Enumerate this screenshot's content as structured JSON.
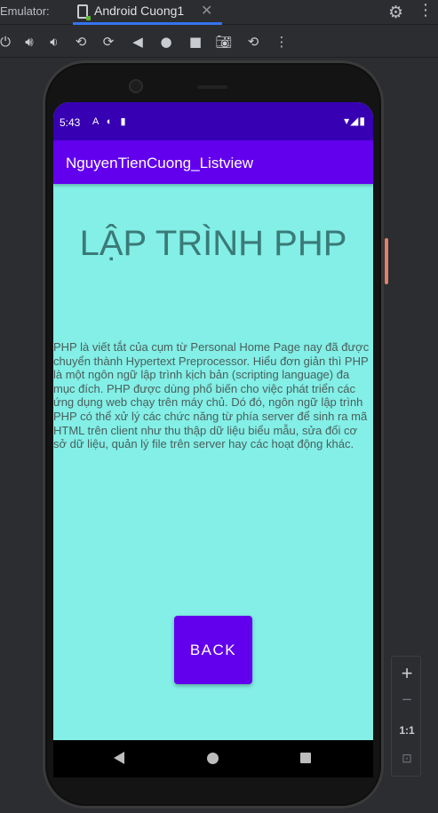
{
  "emulator": {
    "label": "Emulator:",
    "tab_title": "Android Cuong1",
    "tab_close": "✕",
    "settings_icon": "gear-icon",
    "more_icon": "more-options-icon"
  },
  "toolbar": {
    "icons": [
      "power-icon",
      "volume-up-icon",
      "volume-down-icon",
      "rotate-left-icon",
      "rotate-right-icon",
      "back-icon",
      "home-icon",
      "overview-icon",
      "camera-icon",
      "restore-icon",
      "more-icon"
    ]
  },
  "device": {
    "status_time": "5:43",
    "status_left_icons": "A ◐ ▮",
    "status_right_icons": "▾◢▮",
    "app_title": "NguyenTienCuong_Listview",
    "headline": "LẬP TRÌNH PHP",
    "body": "PHP là viết tắt của cụm từ Personal Home Page nay đã được chuyển thành Hypertext Preprocessor. Hiểu đơn giản thì PHP là một ngôn ngữ lập trình kịch bản (scripting language) đa mục đích. PHP được dùng phổ biến cho việc phát triển các ứng dụng web chạy trên máy chủ. Dó đó, ngôn ngữ lập trình PHP có thể xử lý các chức năng từ phía server để sinh ra mã HTML trên client như thu thập dữ liệu biểu mẫu, sửa đổi cơ sở dữ liệu, quản lý file trên server hay các hoạt động khác.",
    "back_button": "BACK",
    "colors": {
      "screen_bg": "#83efe6",
      "app_bar": "#6200ee",
      "status_bar": "#3700b3",
      "headline": "#3a7a78"
    }
  },
  "zoom": {
    "zoom_in": "+",
    "zoom_out": "−",
    "actual_size": "1:1",
    "fit_icon": "fit-screen-icon"
  }
}
